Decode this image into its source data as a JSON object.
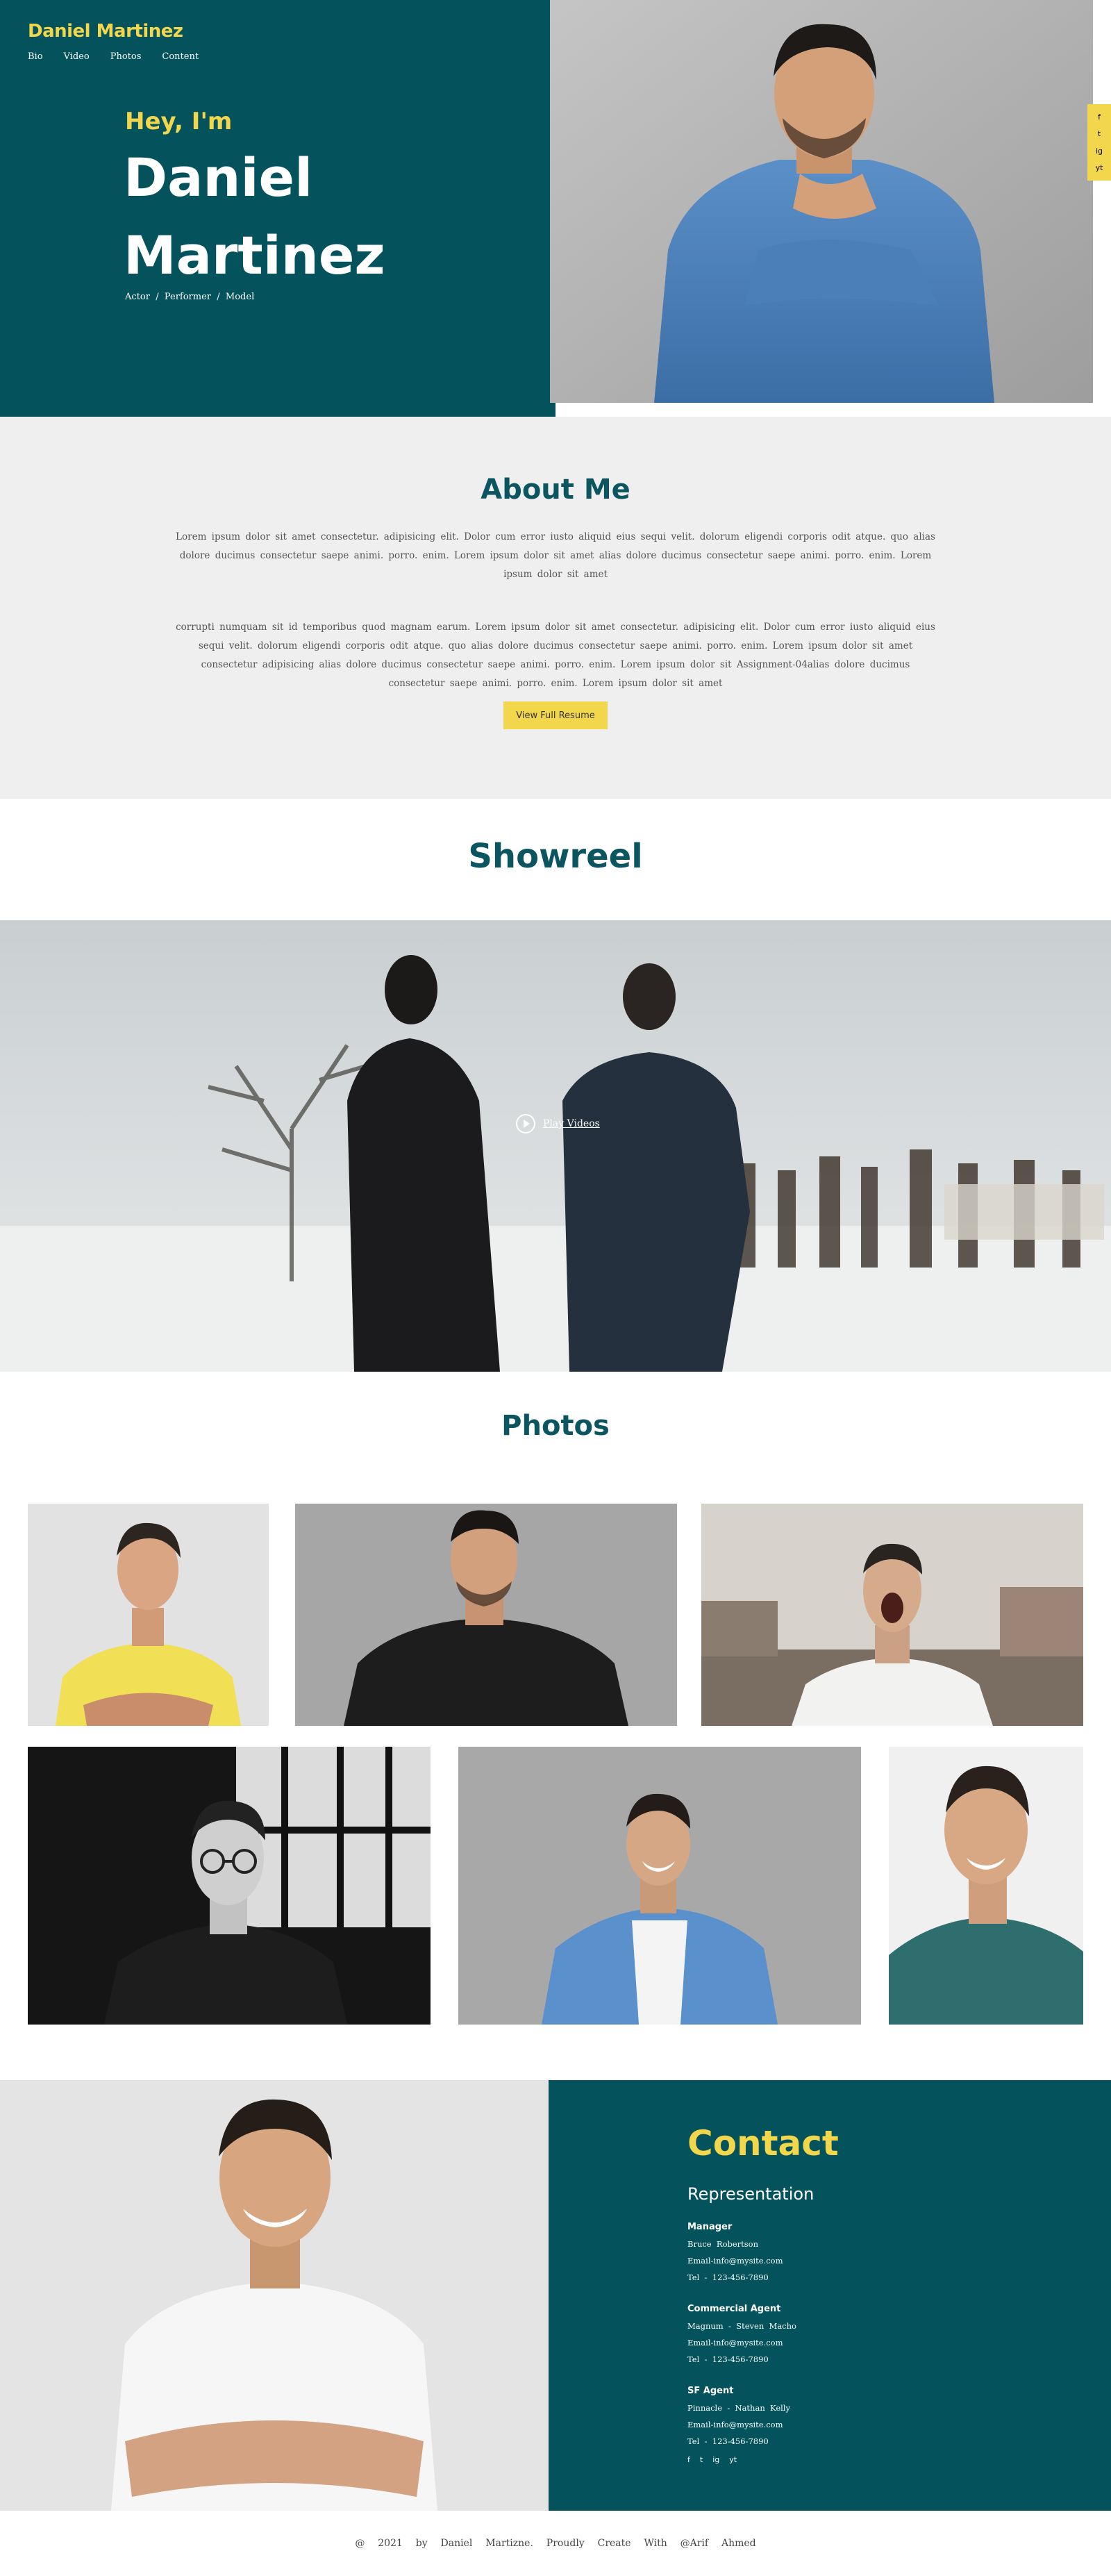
{
  "brand": "Daniel Martinez",
  "nav": [
    "Bio",
    "Video",
    "Photos",
    "Content"
  ],
  "hero": {
    "greeting": "Hey, I'm",
    "name_line1": "Daniel",
    "name_line2": "Martinez",
    "roles": "Actor  /  Performer  /  Model"
  },
  "social_rail": [
    "f",
    "t",
    "ig",
    "yt"
  ],
  "about": {
    "title": "About Me",
    "paragraph1": "Lorem ipsum dolor sit amet consectetur. adipisicing elit. Dolor cum error iusto aliquid eius sequi velit. dolorum eligendi corporis odit atque. quo alias dolore ducimus consectetur saepe animi. porro. enim. Lorem ipsum dolor sit amet alias dolore ducimus consectetur saepe animi. porro. enim. Lorem ipsum dolor sit amet",
    "paragraph2": "corrupti numquam sit id temporibus quod magnam earum. Lorem ipsum dolor sit amet consectetur. adipisicing elit. Dolor cum error iusto aliquid eius sequi velit. dolorum eligendi corporis odit atque. quo alias dolore ducimus consectetur saepe animi. porro. enim. Lorem ipsum dolor sit amet consectetur adipisicing alias dolore ducimus consectetur saepe animi. porro. enim. Lorem ipsum dolor sit Assignment-04alias dolore ducimus consectetur saepe animi. porro. enim. Lorem ipsum dolor sit amet",
    "button": "View Full Resume"
  },
  "showreel": {
    "title": "Showreel",
    "play_label": "Play Videos"
  },
  "photos": {
    "title": "Photos"
  },
  "contact": {
    "title": "Contact",
    "subtitle": "Representation",
    "agents": [
      {
        "role": "Manager",
        "name": "Bruce  Robertson",
        "email": "Email-info@mysite.com",
        "tel": "Tel  -  123-456-7890"
      },
      {
        "role": "Commercial Agent",
        "name": "Magnum  -  Steven  Macho",
        "email": "Email-info@mysite.com",
        "tel": "Tel  -  123-456-7890"
      },
      {
        "role": "SF Agent",
        "name": "Pinnacle  -  Nathan  Kelly",
        "email": "Email-info@mysite.com",
        "tel": "Tel  -  123-456-7890"
      }
    ],
    "social": [
      "f",
      "t",
      "ig",
      "yt"
    ]
  },
  "footer": "@  2021  by  Daniel  Martizne.  Proudly  Create  With  @Arif  Ahmed",
  "colors": {
    "teal": "#04535c",
    "yellow": "#f2d64b",
    "light_gray": "#efefef"
  }
}
